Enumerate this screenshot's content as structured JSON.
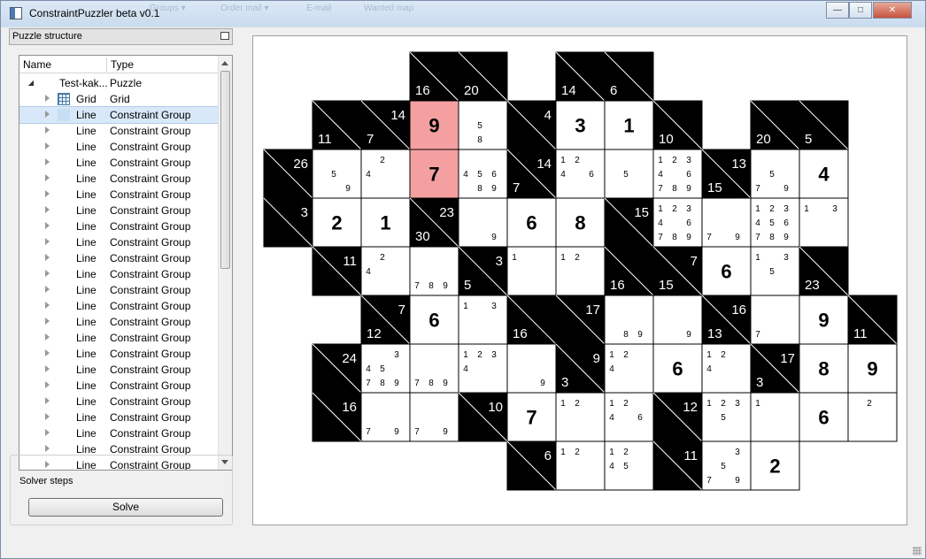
{
  "window": {
    "title": "ConstraintPuzzler beta v0.1",
    "controls": {
      "minimize": "—",
      "maximize": "□",
      "close": "✕"
    },
    "background_menu": [
      "Groups ▾",
      "Order mail ▾",
      "E-mail",
      "Wanted map"
    ]
  },
  "dock": {
    "title": "Puzzle structure",
    "columns": {
      "name": "Name",
      "type": "Type"
    },
    "rows": [
      {
        "name": "Test-kak...",
        "type": "Puzzle",
        "icon": "none",
        "expanded": true,
        "selected": false
      },
      {
        "name": "Grid",
        "type": "Grid",
        "icon": "grid-icon",
        "expanded": false,
        "selected": false
      },
      {
        "name": "Line",
        "type": "Constraint Group",
        "icon": "line-icon",
        "expanded": false,
        "selected": true
      },
      {
        "name": "Line",
        "type": "Constraint Group",
        "icon": "none",
        "expanded": false,
        "selected": false
      },
      {
        "name": "Line",
        "type": "Constraint Group",
        "icon": "none",
        "expanded": false,
        "selected": false
      },
      {
        "name": "Line",
        "type": "Constraint Group",
        "icon": "none",
        "expanded": false,
        "selected": false
      },
      {
        "name": "Line",
        "type": "Constraint Group",
        "icon": "none",
        "expanded": false,
        "selected": false
      },
      {
        "name": "Line",
        "type": "Constraint Group",
        "icon": "none",
        "expanded": false,
        "selected": false
      },
      {
        "name": "Line",
        "type": "Constraint Group",
        "icon": "none",
        "expanded": false,
        "selected": false
      },
      {
        "name": "Line",
        "type": "Constraint Group",
        "icon": "none",
        "expanded": false,
        "selected": false
      },
      {
        "name": "Line",
        "type": "Constraint Group",
        "icon": "none",
        "expanded": false,
        "selected": false
      },
      {
        "name": "Line",
        "type": "Constraint Group",
        "icon": "none",
        "expanded": false,
        "selected": false
      },
      {
        "name": "Line",
        "type": "Constraint Group",
        "icon": "none",
        "expanded": false,
        "selected": false
      },
      {
        "name": "Line",
        "type": "Constraint Group",
        "icon": "none",
        "expanded": false,
        "selected": false
      },
      {
        "name": "Line",
        "type": "Constraint Group",
        "icon": "none",
        "expanded": false,
        "selected": false
      },
      {
        "name": "Line",
        "type": "Constraint Group",
        "icon": "none",
        "expanded": false,
        "selected": false
      },
      {
        "name": "Line",
        "type": "Constraint Group",
        "icon": "none",
        "expanded": false,
        "selected": false
      },
      {
        "name": "Line",
        "type": "Constraint Group",
        "icon": "none",
        "expanded": false,
        "selected": false
      },
      {
        "name": "Line",
        "type": "Constraint Group",
        "icon": "none",
        "expanded": false,
        "selected": false
      },
      {
        "name": "Line",
        "type": "Constraint Group",
        "icon": "none",
        "expanded": false,
        "selected": false
      },
      {
        "name": "Line",
        "type": "Constraint Group",
        "icon": "none",
        "expanded": false,
        "selected": false
      },
      {
        "name": "Line",
        "type": "Constraint Group",
        "icon": "none",
        "expanded": false,
        "selected": false
      },
      {
        "name": "Line",
        "type": "Constraint Group",
        "icon": "none",
        "expanded": false,
        "selected": false
      },
      {
        "name": "Line",
        "type": "Constraint Group",
        "icon": "none",
        "expanded": false,
        "selected": false
      },
      {
        "name": "Line",
        "type": "Constraint Group",
        "icon": "none",
        "expanded": false,
        "selected": false
      },
      {
        "name": "Line",
        "type": "Constraint Group",
        "icon": "none",
        "expanded": false,
        "selected": false
      }
    ]
  },
  "solver": {
    "title": "Solver steps",
    "solve_label": "Solve"
  },
  "puzzle": {
    "highlight_color": "#f4a0a0",
    "cells": [
      {
        "r": 0,
        "c": 3,
        "t": "clue",
        "d": 16
      },
      {
        "r": 0,
        "c": 4,
        "t": "clue",
        "d": 20
      },
      {
        "r": 0,
        "c": 6,
        "t": "clue",
        "d": 14
      },
      {
        "r": 0,
        "c": 7,
        "t": "clue",
        "d": 6
      },
      {
        "r": 1,
        "c": 1,
        "t": "clue",
        "d": 11
      },
      {
        "r": 1,
        "c": 2,
        "t": "clue",
        "a": 14,
        "d": 7
      },
      {
        "r": 1,
        "c": 3,
        "t": "val",
        "v": "9",
        "hl": true
      },
      {
        "r": 1,
        "c": 4,
        "t": "cand",
        "k": [
          5,
          8
        ]
      },
      {
        "r": 1,
        "c": 5,
        "t": "clue",
        "a": 4
      },
      {
        "r": 1,
        "c": 6,
        "t": "val",
        "v": "3"
      },
      {
        "r": 1,
        "c": 7,
        "t": "val",
        "v": "1"
      },
      {
        "r": 1,
        "c": 8,
        "t": "clue",
        "d": 10
      },
      {
        "r": 1,
        "c": 10,
        "t": "clue",
        "d": 20
      },
      {
        "r": 1,
        "c": 11,
        "t": "clue",
        "d": 5
      },
      {
        "r": 2,
        "c": 0,
        "t": "clue",
        "a": 26
      },
      {
        "r": 2,
        "c": 1,
        "t": "cand",
        "k": [
          5,
          9
        ]
      },
      {
        "r": 2,
        "c": 2,
        "t": "cand",
        "k": [
          2,
          4
        ]
      },
      {
        "r": 2,
        "c": 3,
        "t": "val",
        "v": "7",
        "hl": true
      },
      {
        "r": 2,
        "c": 4,
        "t": "cand",
        "k": [
          4,
          5,
          6,
          8,
          9
        ]
      },
      {
        "r": 2,
        "c": 5,
        "t": "clue",
        "a": 14,
        "d": 7
      },
      {
        "r": 2,
        "c": 6,
        "t": "cand",
        "k": [
          1,
          2,
          4,
          6
        ]
      },
      {
        "r": 2,
        "c": 7,
        "t": "cand",
        "k": [
          5
        ]
      },
      {
        "r": 2,
        "c": 8,
        "t": "cand",
        "k": [
          1,
          2,
          3,
          4,
          6,
          7,
          8,
          9
        ]
      },
      {
        "r": 2,
        "c": 9,
        "t": "clue",
        "a": 13,
        "d": 15
      },
      {
        "r": 2,
        "c": 10,
        "t": "cand",
        "k": [
          5,
          7,
          9
        ]
      },
      {
        "r": 2,
        "c": 11,
        "t": "val",
        "v": "4"
      },
      {
        "r": 3,
        "c": 0,
        "t": "clue",
        "a": 3
      },
      {
        "r": 3,
        "c": 1,
        "t": "val",
        "v": "2"
      },
      {
        "r": 3,
        "c": 2,
        "t": "val",
        "v": "1"
      },
      {
        "r": 3,
        "c": 3,
        "t": "clue",
        "a": 23,
        "d": 30
      },
      {
        "r": 3,
        "c": 4,
        "t": "cand",
        "k": [
          9
        ]
      },
      {
        "r": 3,
        "c": 5,
        "t": "val",
        "v": "6"
      },
      {
        "r": 3,
        "c": 6,
        "t": "val",
        "v": "8"
      },
      {
        "r": 3,
        "c": 7,
        "t": "clue",
        "a": 15
      },
      {
        "r": 3,
        "c": 8,
        "t": "cand",
        "k": [
          1,
          2,
          3,
          4,
          6,
          7,
          8,
          9
        ]
      },
      {
        "r": 3,
        "c": 9,
        "t": "cand",
        "k": [
          7,
          9
        ]
      },
      {
        "r": 3,
        "c": 10,
        "t": "cand",
        "k": [
          1,
          2,
          3,
          4,
          5,
          6,
          7,
          8,
          9
        ]
      },
      {
        "r": 3,
        "c": 11,
        "t": "cand",
        "k": [
          1,
          3
        ]
      },
      {
        "r": 4,
        "c": 1,
        "t": "clue",
        "a": 11
      },
      {
        "r": 4,
        "c": 2,
        "t": "cand",
        "k": [
          2,
          4
        ]
      },
      {
        "r": 4,
        "c": 3,
        "t": "cand",
        "k": [
          7,
          8,
          9
        ]
      },
      {
        "r": 4,
        "c": 4,
        "t": "clue",
        "a": 3,
        "d": 5
      },
      {
        "r": 4,
        "c": 5,
        "t": "cand",
        "k": [
          1
        ]
      },
      {
        "r": 4,
        "c": 6,
        "t": "cand",
        "k": [
          1,
          2
        ]
      },
      {
        "r": 4,
        "c": 7,
        "t": "clue",
        "d": 16
      },
      {
        "r": 4,
        "c": 8,
        "t": "clue",
        "a": 7,
        "d": 15
      },
      {
        "r": 4,
        "c": 9,
        "t": "val",
        "v": "6"
      },
      {
        "r": 4,
        "c": 10,
        "t": "cand",
        "k": [
          1,
          3,
          5
        ]
      },
      {
        "r": 4,
        "c": 11,
        "t": "clue",
        "d": 23
      },
      {
        "r": 5,
        "c": 2,
        "t": "clue",
        "a": 7,
        "d": 12
      },
      {
        "r": 5,
        "c": 3,
        "t": "val",
        "v": "6"
      },
      {
        "r": 5,
        "c": 4,
        "t": "cand",
        "k": [
          1,
          3
        ]
      },
      {
        "r": 5,
        "c": 5,
        "t": "clue",
        "d": 16
      },
      {
        "r": 5,
        "c": 6,
        "t": "clue",
        "a": 17
      },
      {
        "r": 5,
        "c": 7,
        "t": "cand",
        "k": [
          8,
          9
        ]
      },
      {
        "r": 5,
        "c": 8,
        "t": "cand",
        "k": [
          9
        ]
      },
      {
        "r": 5,
        "c": 9,
        "t": "clue",
        "a": 16,
        "d": 13
      },
      {
        "r": 5,
        "c": 10,
        "t": "cand",
        "k": [
          7
        ]
      },
      {
        "r": 5,
        "c": 11,
        "t": "val",
        "v": "9"
      },
      {
        "r": 5,
        "c": 12,
        "t": "clue",
        "d": 11
      },
      {
        "r": 6,
        "c": 1,
        "t": "clue",
        "a": 24
      },
      {
        "r": 6,
        "c": 2,
        "t": "cand",
        "k": [
          3,
          4,
          5,
          7,
          8,
          9
        ]
      },
      {
        "r": 6,
        "c": 3,
        "t": "cand",
        "k": [
          7,
          8,
          9
        ]
      },
      {
        "r": 6,
        "c": 4,
        "t": "cand",
        "k": [
          1,
          2,
          3,
          4
        ]
      },
      {
        "r": 6,
        "c": 5,
        "t": "cand",
        "k": [
          9
        ]
      },
      {
        "r": 6,
        "c": 6,
        "t": "clue",
        "a": 9,
        "d": 3
      },
      {
        "r": 6,
        "c": 7,
        "t": "cand",
        "k": [
          1,
          2,
          4
        ]
      },
      {
        "r": 6,
        "c": 8,
        "t": "val",
        "v": "6"
      },
      {
        "r": 6,
        "c": 9,
        "t": "cand",
        "k": [
          1,
          2,
          4
        ]
      },
      {
        "r": 6,
        "c": 10,
        "t": "clue",
        "a": 17,
        "d": 3
      },
      {
        "r": 6,
        "c": 11,
        "t": "val",
        "v": "8"
      },
      {
        "r": 6,
        "c": 12,
        "t": "val",
        "v": "9"
      },
      {
        "r": 7,
        "c": 1,
        "t": "clue",
        "a": 16
      },
      {
        "r": 7,
        "c": 2,
        "t": "cand",
        "k": [
          7,
          9
        ]
      },
      {
        "r": 7,
        "c": 3,
        "t": "cand",
        "k": [
          7,
          9
        ]
      },
      {
        "r": 7,
        "c": 4,
        "t": "clue",
        "a": 10
      },
      {
        "r": 7,
        "c": 5,
        "t": "val",
        "v": "7"
      },
      {
        "r": 7,
        "c": 6,
        "t": "cand",
        "k": [
          1,
          2
        ]
      },
      {
        "r": 7,
        "c": 7,
        "t": "cand",
        "k": [
          1,
          2,
          4,
          6
        ]
      },
      {
        "r": 7,
        "c": 8,
        "t": "clue",
        "a": 12
      },
      {
        "r": 7,
        "c": 9,
        "t": "cand",
        "k": [
          1,
          2,
          3,
          5
        ]
      },
      {
        "r": 7,
        "c": 10,
        "t": "cand",
        "k": [
          1
        ]
      },
      {
        "r": 7,
        "c": 11,
        "t": "val",
        "v": "6"
      },
      {
        "r": 7,
        "c": 12,
        "t": "cand",
        "k": [
          2
        ]
      },
      {
        "r": 8,
        "c": 5,
        "t": "clue",
        "a": 6
      },
      {
        "r": 8,
        "c": 6,
        "t": "cand",
        "k": [
          1,
          2
        ]
      },
      {
        "r": 8,
        "c": 7,
        "t": "cand",
        "k": [
          1,
          2,
          4,
          5
        ]
      },
      {
        "r": 8,
        "c": 8,
        "t": "clue",
        "a": 11
      },
      {
        "r": 8,
        "c": 9,
        "t": "cand",
        "k": [
          3,
          5,
          7,
          9
        ]
      },
      {
        "r": 8,
        "c": 10,
        "t": "val",
        "v": "2"
      }
    ]
  }
}
